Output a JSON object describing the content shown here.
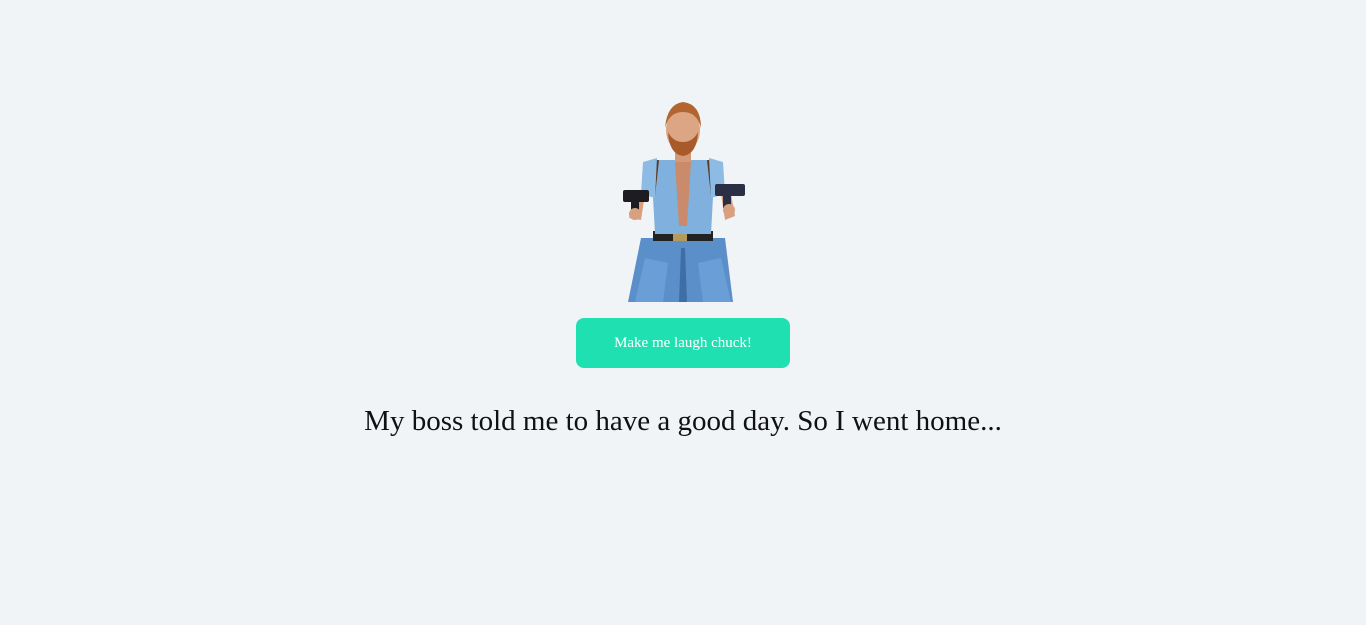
{
  "hero": {
    "image_icon": "chuck-norris-portrait"
  },
  "button": {
    "label": "Make me laugh chuck!",
    "color": "#1fe0b1"
  },
  "joke": {
    "text": "My boss told me to have a good day. So I went home..."
  },
  "theme": {
    "background": "#f1f4f7"
  }
}
